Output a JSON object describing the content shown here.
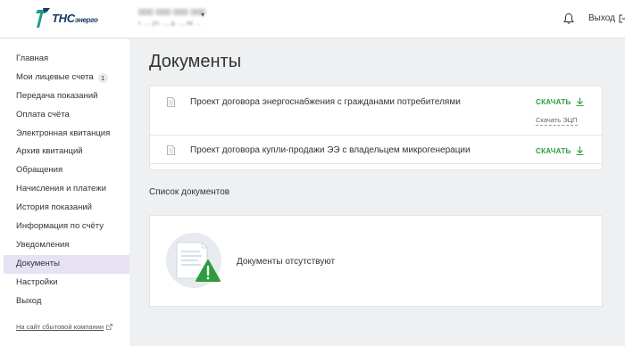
{
  "header": {
    "logo_text": "ТНС",
    "logo_sub": "энерго",
    "account_number": "000 000 000 000",
    "account_address": "г. ..., ул. ..., д. ..., кв. ...",
    "logout_label": "Выход"
  },
  "sidebar": {
    "items": [
      {
        "label": "Главная"
      },
      {
        "label": "Мои лицевые счета",
        "badge": "1"
      },
      {
        "label": "Передача показаний"
      },
      {
        "label": "Оплата счёта"
      },
      {
        "label": "Электронная квитанция"
      },
      {
        "label": "Архив квитанций"
      },
      {
        "label": "Обращения"
      },
      {
        "label": "Начисления и платежи"
      },
      {
        "label": "История показаний"
      },
      {
        "label": "Информация по счёту"
      },
      {
        "label": "Уведомления"
      },
      {
        "label": "Документы",
        "active": true
      },
      {
        "label": "Настройки"
      },
      {
        "label": "Выход"
      }
    ],
    "external_link": "На сайт сбытовой компании"
  },
  "main": {
    "title": "Документы",
    "documents": [
      {
        "title": "Проект договора энергоснабжения с гражданами потребителями",
        "download_label": "СКАЧАТЬ",
        "ecp_label": "Скачать ЭЦП"
      },
      {
        "title": "Проект договора купли-продажи ЭЭ с владельцем микрогенерации",
        "download_label": "СКАЧАТЬ"
      }
    ],
    "list_title": "Список документов",
    "empty_text": "Документы отсутствуют"
  },
  "colors": {
    "accent_green": "#2e9b3f",
    "active_menu_bg": "#e6e2f4",
    "page_bg": "#eef0f2",
    "logo_blue": "#173b66",
    "logo_teal": "#1f9a8a"
  }
}
